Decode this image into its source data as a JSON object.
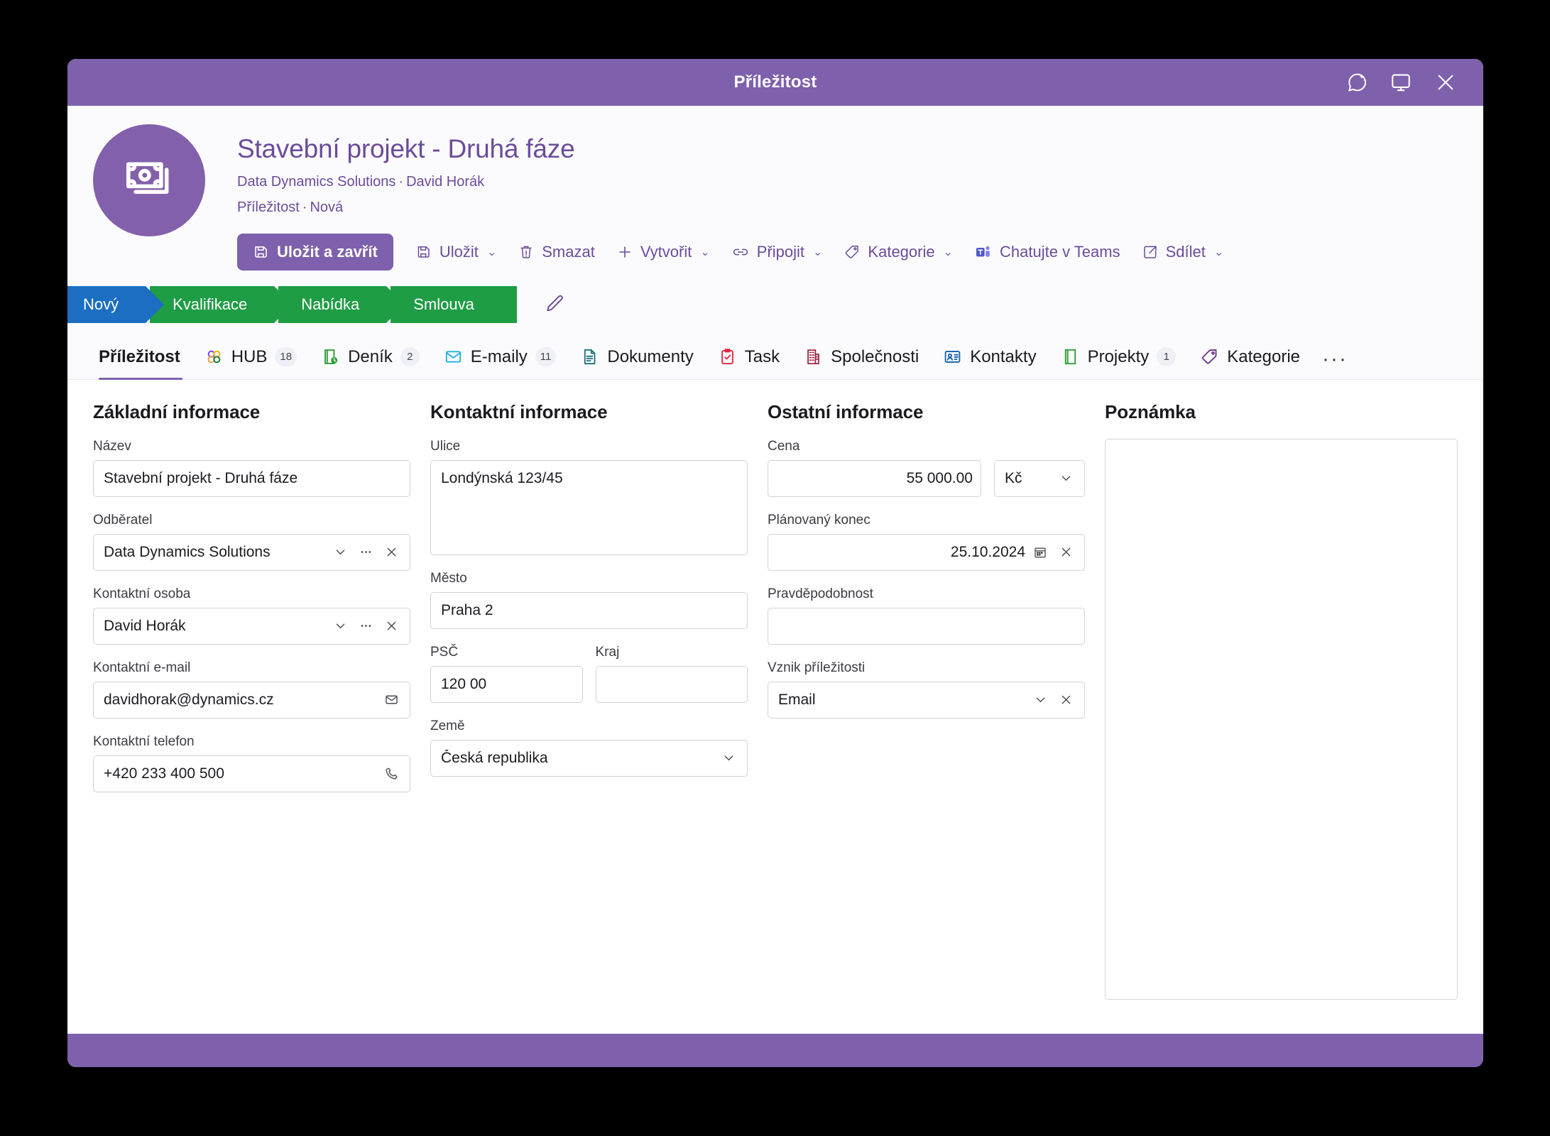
{
  "window": {
    "title": "Příležitost",
    "titlebar_icons": [
      {
        "name": "copilot-icon",
        "label": "Copilot"
      },
      {
        "name": "popout-icon",
        "label": "Otevřít v novém okně"
      },
      {
        "name": "close-icon",
        "label": "Zavřít"
      }
    ]
  },
  "header": {
    "avatar_icon": "money-icon",
    "record_title": "Stavební projekt - Druhá fáze",
    "subtitle_company": "Data Dynamics Solutions",
    "subtitle_sep": "·",
    "subtitle_person": "David Horák",
    "entity_label": "Příležitost",
    "entity_sep": "·",
    "entity_state": "Nová"
  },
  "commandbar": [
    {
      "label": "Uložit a zavřít",
      "icon": "save-close-icon",
      "primary": true,
      "caret": false
    },
    {
      "label": "Uložit",
      "icon": "save-icon",
      "primary": false,
      "caret": true
    },
    {
      "label": "Smazat",
      "icon": "delete-icon",
      "primary": false,
      "caret": false
    },
    {
      "label": "Vytvořit",
      "icon": "plus-icon",
      "primary": false,
      "caret": true
    },
    {
      "label": "Připojit",
      "icon": "link-icon",
      "primary": false,
      "caret": true
    },
    {
      "label": "Kategorie",
      "icon": "tag-icon",
      "primary": false,
      "caret": true
    },
    {
      "label": "Chatujte v Teams",
      "icon": "teams-icon",
      "primary": false,
      "caret": false
    },
    {
      "label": "Sdílet",
      "icon": "share-icon",
      "primary": false,
      "caret": true
    }
  ],
  "stages": [
    {
      "label": "Nový",
      "color": "#1b6ec2",
      "active": true
    },
    {
      "label": "Kvalifikace",
      "color": "#1f9d45",
      "active": false
    },
    {
      "label": "Nabídka",
      "color": "#1f9d45",
      "active": false
    },
    {
      "label": "Smlouva",
      "color": "#1f9d45",
      "active": false
    }
  ],
  "stage_edit_icon": "pencil-icon",
  "tabs": [
    {
      "label": "Příležitost",
      "icon": null,
      "badge": null,
      "active": true
    },
    {
      "label": "HUB",
      "icon": "hub-flower-icon",
      "badge": "18",
      "active": false
    },
    {
      "label": "Deník",
      "icon": "journal-icon",
      "badge": "2",
      "active": false
    },
    {
      "label": "E-maily",
      "icon": "email-icon",
      "badge": "11",
      "active": false
    },
    {
      "label": "Dokumenty",
      "icon": "document-icon",
      "badge": null,
      "active": false
    },
    {
      "label": "Task",
      "icon": "task-icon",
      "badge": null,
      "active": false
    },
    {
      "label": "Společnosti",
      "icon": "company-icon",
      "badge": null,
      "active": false
    },
    {
      "label": "Kontakty",
      "icon": "contacts-icon",
      "badge": null,
      "active": false
    },
    {
      "label": "Projekty",
      "icon": "projects-icon",
      "badge": "1",
      "active": false
    },
    {
      "label": "Kategorie",
      "icon": "category-tag-icon",
      "badge": null,
      "active": false
    }
  ],
  "tabs_overflow_label": "···",
  "sections": {
    "basic": {
      "title": "Základní informace",
      "nazev": {
        "label": "Název",
        "value": "Stavební projekt - Druhá fáze"
      },
      "odberatel": {
        "label": "Odběratel",
        "value": "Data Dynamics Solutions"
      },
      "kontaktni_osoba": {
        "label": "Kontaktní osoba",
        "value": "David Horák"
      },
      "kontaktni_email": {
        "label": "Kontaktní e-mail",
        "value": "davidhorak@dynamics.cz"
      },
      "kontaktni_telefon": {
        "label": "Kontaktní telefon",
        "value": "+420 233 400 500"
      }
    },
    "contact": {
      "title": "Kontaktní informace",
      "ulice": {
        "label": "Ulice",
        "value": "Londýnská 123/45"
      },
      "mesto": {
        "label": "Město",
        "value": "Praha 2"
      },
      "psc": {
        "label": "PSČ",
        "value": "120 00"
      },
      "kraj": {
        "label": "Kraj",
        "value": ""
      },
      "zeme": {
        "label": "Země",
        "value": "Česká republika"
      }
    },
    "other": {
      "title": "Ostatní informace",
      "cena": {
        "label": "Cena",
        "value": "55 000.00",
        "currency": "Kč"
      },
      "planovany_konec": {
        "label": "Plánovaný konec",
        "value": "25.10.2024"
      },
      "pravdepodobnost": {
        "label": "Pravděpodobnost",
        "value": ""
      },
      "vznik": {
        "label": "Vznik příležitosti",
        "value": "Email"
      }
    },
    "note": {
      "title": "Poznámka",
      "value": ""
    }
  },
  "colors": {
    "brand_purple": "#7e60ac",
    "title_purple": "#6b4c9a",
    "stage_active_blue": "#1b6ec2",
    "stage_green": "#1f9d45"
  }
}
